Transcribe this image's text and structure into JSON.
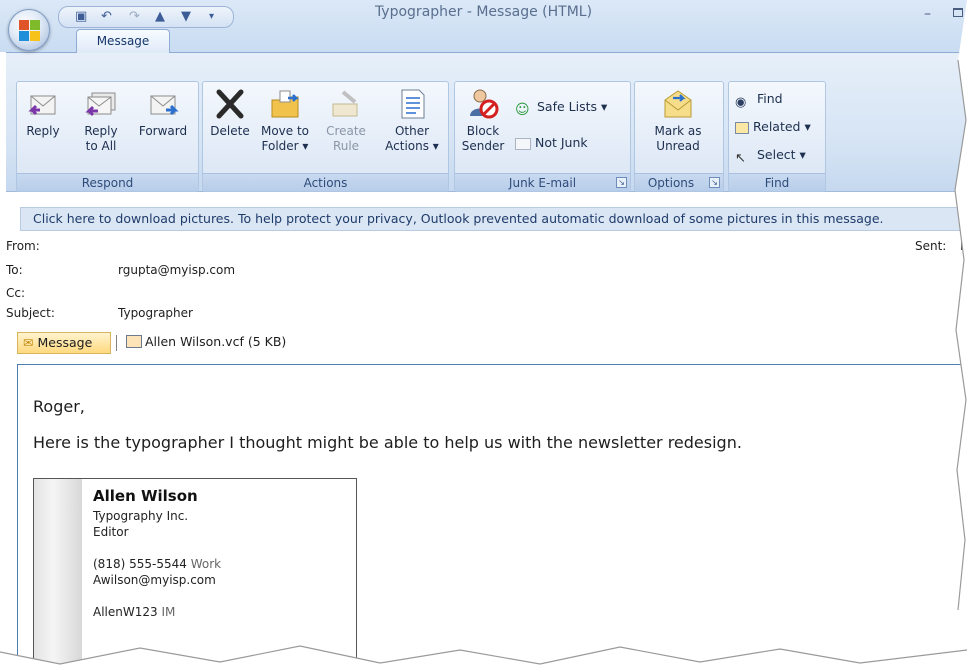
{
  "window": {
    "title": "Typographer - Message (HTML)",
    "minimize_glyph": "–"
  },
  "quick_access": [
    "save-icon",
    "undo-icon",
    "redo-icon",
    "previous-icon",
    "next-icon",
    "customize-icon"
  ],
  "tabs": [
    {
      "label": "Message",
      "selected": true
    }
  ],
  "ribbon": {
    "groups": {
      "respond": {
        "label": "Respond",
        "reply": "Reply",
        "reply_all_1": "Reply",
        "reply_all_2": "to All",
        "forward": "Forward"
      },
      "actions": {
        "label": "Actions",
        "delete": "Delete",
        "move_1": "Move to",
        "move_2": "Folder ▾",
        "create_1": "Create",
        "create_2": "Rule",
        "other_1": "Other",
        "other_2": "Actions ▾"
      },
      "junk": {
        "label": "Junk E-mail",
        "block_1": "Block",
        "block_2": "Sender",
        "safe_lists": "Safe Lists ▾",
        "not_junk": "Not Junk"
      },
      "options": {
        "label": "Options",
        "mark_1": "Mark as",
        "mark_2": "Unread"
      },
      "find": {
        "label": "Find",
        "find": "Find",
        "related": "Related ▾",
        "select": "Select ▾"
      }
    }
  },
  "infobar": "Click here to download pictures. To help protect your privacy, Outlook prevented automatic download of some pictures in this message.",
  "header": {
    "from_label": "From:",
    "to_label": "To:",
    "to_value": "rgupta@myisp.com",
    "cc_label": "Cc:",
    "subject_label": "Subject:",
    "subject_value": "Typographer",
    "sent_label": "Sent:",
    "sent_value": "M"
  },
  "attachments": {
    "message_tab": "Message",
    "vcf_file": "Allen Wilson.vcf (5 KB)"
  },
  "body": {
    "greeting": "Roger,",
    "text": "Here is the typographer I thought might be able to help us with the newsletter redesign."
  },
  "vcard": {
    "name": "Allen Wilson",
    "company": "Typography Inc.",
    "title": "Editor",
    "phone": "(818) 555-5544",
    "phone_tag": "Work",
    "email": "Awilson@myisp.com",
    "im": "AllenW123",
    "im_tag": "IM"
  }
}
